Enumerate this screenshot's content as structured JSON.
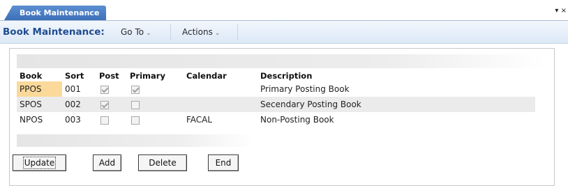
{
  "tab": {
    "label": "Book Maintenance",
    "controls": "▾ ×"
  },
  "header": {
    "title": "Book Maintenance:",
    "menus": [
      {
        "label": "Go To",
        "chevron": "⌄"
      },
      {
        "label": "Actions",
        "chevron": "⌄"
      }
    ]
  },
  "table": {
    "columns": [
      "Book",
      "Sort",
      "Post",
      "Primary",
      "Calendar",
      "Description"
    ],
    "rows": [
      {
        "book": "PPOS",
        "sort": "001",
        "post": true,
        "primary": true,
        "calendar": "",
        "description": "Primary Posting Book"
      },
      {
        "book": "SPOS",
        "sort": "002",
        "post": true,
        "primary": false,
        "calendar": "",
        "description": "Secendary Posting Book"
      },
      {
        "book": "NPOS",
        "sort": "003",
        "post": false,
        "primary": false,
        "calendar": "FACAL",
        "description": "Non-Posting Book"
      }
    ]
  },
  "buttons": {
    "update": "Update",
    "add": "Add",
    "delete": "Delete",
    "end": "End"
  },
  "colors": {
    "selected_cell": "#fbd99a",
    "header_title": "#1f4c8f",
    "tab": "#3c6fb8"
  }
}
